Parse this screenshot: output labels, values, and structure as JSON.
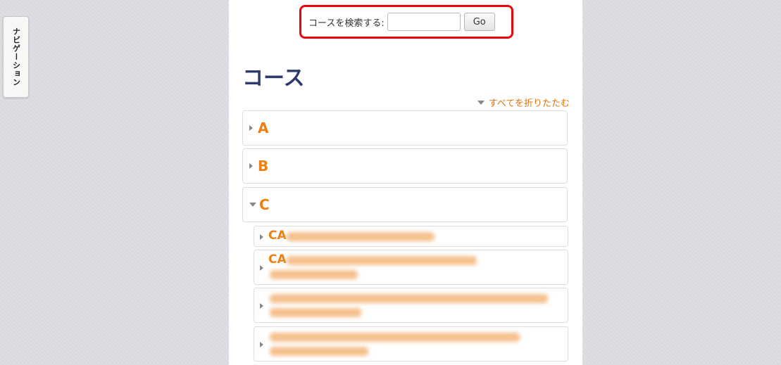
{
  "navigation": {
    "label": "ナビゲーション"
  },
  "search": {
    "label": "コースを検索する:",
    "value": "",
    "go_label": "Go"
  },
  "page": {
    "title": "コース",
    "collapse_all": "すべてを折りたたむ"
  },
  "categories": [
    {
      "label": "A",
      "expanded": false
    },
    {
      "label": "B",
      "expanded": false
    },
    {
      "label": "C",
      "expanded": true
    }
  ],
  "subcategories": [
    {
      "label": "CA"
    },
    {
      "label": "CA"
    },
    {
      "label": ""
    },
    {
      "label": ""
    }
  ],
  "colors": {
    "accent": "#f07e10",
    "title": "#2f3b6c",
    "highlight": "#e8070a"
  }
}
